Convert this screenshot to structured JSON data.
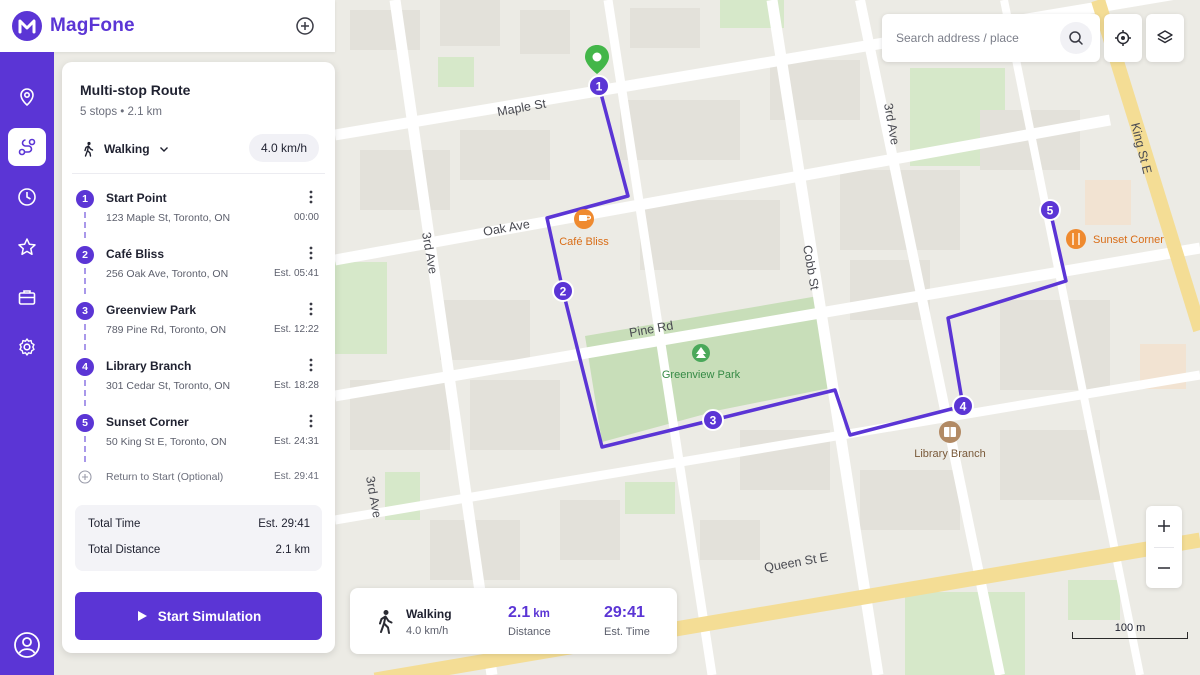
{
  "app": {
    "name": "MagFone",
    "brand_color": "#5b35d5"
  },
  "rail": {
    "items": [
      {
        "icon": "location-pin-icon",
        "active": false
      },
      {
        "icon": "route-icon",
        "active": true
      },
      {
        "icon": "clock-icon",
        "active": false
      },
      {
        "icon": "star-icon",
        "active": false
      },
      {
        "icon": "briefcase-icon",
        "active": false
      },
      {
        "icon": "gear-icon",
        "active": false
      }
    ],
    "profile_icon": "user-circle-icon"
  },
  "route": {
    "title": "Multi-stop Route",
    "subtitle": "5 stops • 2.1 km",
    "mode": "Walking",
    "speed": "4.0 km/h",
    "stops": [
      {
        "num": "1",
        "name": "Start Point",
        "address": "123 Maple St, Toronto, ON",
        "eta": "00:00"
      },
      {
        "num": "2",
        "name": "Café Bliss",
        "address": "256 Oak Ave, Toronto, ON",
        "eta": "Est. 05:41"
      },
      {
        "num": "3",
        "name": "Greenview Park",
        "address": "789 Pine Rd, Toronto, ON",
        "eta": "Est. 12:22"
      },
      {
        "num": "4",
        "name": "Library Branch",
        "address": "301 Cedar St, Toronto, ON",
        "eta": "Est. 18:28"
      },
      {
        "num": "5",
        "name": "Sunset Corner",
        "address": "50 King St E, Toronto, ON",
        "eta": "Est. 24:31"
      }
    ],
    "return_label": "Return to Start (Optional)",
    "return_eta": "Est. 29:41",
    "totals": {
      "time_label": "Total Time",
      "time_value": "Est. 29:41",
      "distance_label": "Total Distance",
      "distance_value": "2.1 km"
    },
    "start_button": "Start Simulation"
  },
  "search": {
    "placeholder": "Search address / place",
    "value": ""
  },
  "map": {
    "streets": {
      "maple": "Maple St",
      "oak": "Oak Ave",
      "pine": "Pine Rd",
      "third_a": "3rd Ave",
      "third_b": "3rd Ave",
      "third_c": "3rd Ave",
      "cobb": "Cobb St",
      "king": "King St E",
      "queen": "Queen St E"
    },
    "places": {
      "cafe": "Café Bliss",
      "park": "Greenview Park",
      "library": "Library Branch",
      "sunset": "Sunset Corner"
    },
    "markers": [
      "1",
      "2",
      "3",
      "4",
      "5"
    ],
    "route_color": "#5b35d5",
    "scale": "100 m"
  },
  "summary": {
    "mode": "Walking",
    "speed": "4.0 km/h",
    "distance_value": "2.1",
    "distance_unit": "km",
    "distance_label": "Distance",
    "time_value": "29:41",
    "time_label": "Est. Time"
  }
}
